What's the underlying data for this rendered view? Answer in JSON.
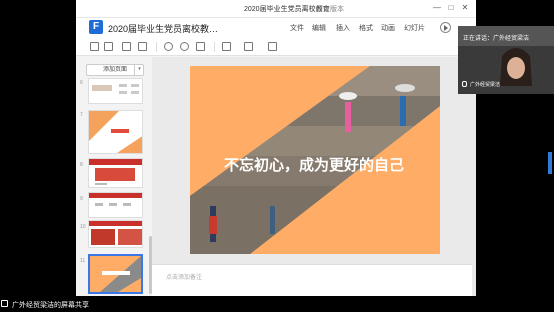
{
  "window": {
    "title": "2020届毕业生党员离校教育",
    "history_label": "历史版本",
    "minimize": "—",
    "maximize": "□",
    "close": "✕"
  },
  "app": {
    "document_title": "2020届毕业生党员离校教…",
    "menu": [
      "文件",
      "编辑",
      "插入",
      "格式",
      "动画",
      "幻灯片"
    ],
    "add_page_label": "添加页面",
    "add_page_dropdown": "▾",
    "notes_placeholder": "点击添加备注"
  },
  "thumbnails": {
    "page_numbers": [
      "6",
      "7",
      "8",
      "9",
      "10",
      "11"
    ]
  },
  "slide": {
    "headline": "不忘初心，成为更好的自己",
    "accent_color": "#ffac66"
  },
  "camera": {
    "speaking_label": "正在讲话：广外经贸梁洁",
    "participant_name": "广外经贸梁洁"
  },
  "share_bar": {
    "label": "广外经贸梁洁的屏幕共享"
  }
}
